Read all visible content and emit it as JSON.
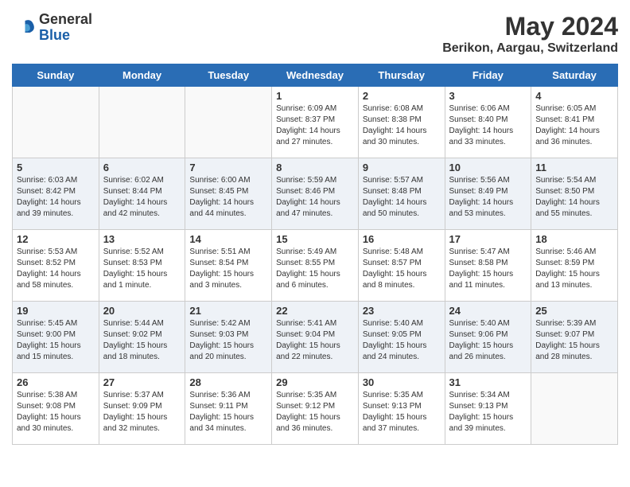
{
  "logo": {
    "general": "General",
    "blue": "Blue"
  },
  "title": "May 2024",
  "subtitle": "Berikon, Aargau, Switzerland",
  "days_of_week": [
    "Sunday",
    "Monday",
    "Tuesday",
    "Wednesday",
    "Thursday",
    "Friday",
    "Saturday"
  ],
  "weeks": [
    {
      "cells": [
        {
          "day": null,
          "info": null
        },
        {
          "day": null,
          "info": null
        },
        {
          "day": null,
          "info": null
        },
        {
          "day": "1",
          "info": "Sunrise: 6:09 AM\nSunset: 8:37 PM\nDaylight: 14 hours\nand 27 minutes."
        },
        {
          "day": "2",
          "info": "Sunrise: 6:08 AM\nSunset: 8:38 PM\nDaylight: 14 hours\nand 30 minutes."
        },
        {
          "day": "3",
          "info": "Sunrise: 6:06 AM\nSunset: 8:40 PM\nDaylight: 14 hours\nand 33 minutes."
        },
        {
          "day": "4",
          "info": "Sunrise: 6:05 AM\nSunset: 8:41 PM\nDaylight: 14 hours\nand 36 minutes."
        }
      ]
    },
    {
      "cells": [
        {
          "day": "5",
          "info": "Sunrise: 6:03 AM\nSunset: 8:42 PM\nDaylight: 14 hours\nand 39 minutes."
        },
        {
          "day": "6",
          "info": "Sunrise: 6:02 AM\nSunset: 8:44 PM\nDaylight: 14 hours\nand 42 minutes."
        },
        {
          "day": "7",
          "info": "Sunrise: 6:00 AM\nSunset: 8:45 PM\nDaylight: 14 hours\nand 44 minutes."
        },
        {
          "day": "8",
          "info": "Sunrise: 5:59 AM\nSunset: 8:46 PM\nDaylight: 14 hours\nand 47 minutes."
        },
        {
          "day": "9",
          "info": "Sunrise: 5:57 AM\nSunset: 8:48 PM\nDaylight: 14 hours\nand 50 minutes."
        },
        {
          "day": "10",
          "info": "Sunrise: 5:56 AM\nSunset: 8:49 PM\nDaylight: 14 hours\nand 53 minutes."
        },
        {
          "day": "11",
          "info": "Sunrise: 5:54 AM\nSunset: 8:50 PM\nDaylight: 14 hours\nand 55 minutes."
        }
      ]
    },
    {
      "cells": [
        {
          "day": "12",
          "info": "Sunrise: 5:53 AM\nSunset: 8:52 PM\nDaylight: 14 hours\nand 58 minutes."
        },
        {
          "day": "13",
          "info": "Sunrise: 5:52 AM\nSunset: 8:53 PM\nDaylight: 15 hours\nand 1 minute."
        },
        {
          "day": "14",
          "info": "Sunrise: 5:51 AM\nSunset: 8:54 PM\nDaylight: 15 hours\nand 3 minutes."
        },
        {
          "day": "15",
          "info": "Sunrise: 5:49 AM\nSunset: 8:55 PM\nDaylight: 15 hours\nand 6 minutes."
        },
        {
          "day": "16",
          "info": "Sunrise: 5:48 AM\nSunset: 8:57 PM\nDaylight: 15 hours\nand 8 minutes."
        },
        {
          "day": "17",
          "info": "Sunrise: 5:47 AM\nSunset: 8:58 PM\nDaylight: 15 hours\nand 11 minutes."
        },
        {
          "day": "18",
          "info": "Sunrise: 5:46 AM\nSunset: 8:59 PM\nDaylight: 15 hours\nand 13 minutes."
        }
      ]
    },
    {
      "cells": [
        {
          "day": "19",
          "info": "Sunrise: 5:45 AM\nSunset: 9:00 PM\nDaylight: 15 hours\nand 15 minutes."
        },
        {
          "day": "20",
          "info": "Sunrise: 5:44 AM\nSunset: 9:02 PM\nDaylight: 15 hours\nand 18 minutes."
        },
        {
          "day": "21",
          "info": "Sunrise: 5:42 AM\nSunset: 9:03 PM\nDaylight: 15 hours\nand 20 minutes."
        },
        {
          "day": "22",
          "info": "Sunrise: 5:41 AM\nSunset: 9:04 PM\nDaylight: 15 hours\nand 22 minutes."
        },
        {
          "day": "23",
          "info": "Sunrise: 5:40 AM\nSunset: 9:05 PM\nDaylight: 15 hours\nand 24 minutes."
        },
        {
          "day": "24",
          "info": "Sunrise: 5:40 AM\nSunset: 9:06 PM\nDaylight: 15 hours\nand 26 minutes."
        },
        {
          "day": "25",
          "info": "Sunrise: 5:39 AM\nSunset: 9:07 PM\nDaylight: 15 hours\nand 28 minutes."
        }
      ]
    },
    {
      "cells": [
        {
          "day": "26",
          "info": "Sunrise: 5:38 AM\nSunset: 9:08 PM\nDaylight: 15 hours\nand 30 minutes."
        },
        {
          "day": "27",
          "info": "Sunrise: 5:37 AM\nSunset: 9:09 PM\nDaylight: 15 hours\nand 32 minutes."
        },
        {
          "day": "28",
          "info": "Sunrise: 5:36 AM\nSunset: 9:11 PM\nDaylight: 15 hours\nand 34 minutes."
        },
        {
          "day": "29",
          "info": "Sunrise: 5:35 AM\nSunset: 9:12 PM\nDaylight: 15 hours\nand 36 minutes."
        },
        {
          "day": "30",
          "info": "Sunrise: 5:35 AM\nSunset: 9:13 PM\nDaylight: 15 hours\nand 37 minutes."
        },
        {
          "day": "31",
          "info": "Sunrise: 5:34 AM\nSunset: 9:13 PM\nDaylight: 15 hours\nand 39 minutes."
        },
        {
          "day": null,
          "info": null
        }
      ]
    }
  ]
}
